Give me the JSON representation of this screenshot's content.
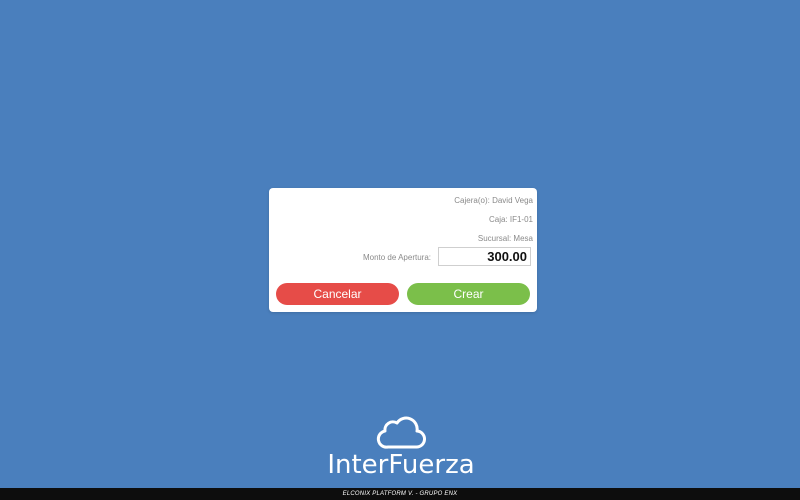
{
  "dialog": {
    "cashier_line": "Cajera(o): David Vega",
    "register_line": "Caja: IF1-01",
    "branch_line": "Sucursal: Mesa",
    "opening_amount_label": "Monto de Apertura:",
    "opening_amount_value": "300.00",
    "cancel_label": "Cancelar",
    "create_label": "Crear"
  },
  "logo": {
    "text": "InterFuerza",
    "icon": "cloud-icon"
  },
  "footer": {
    "text": "ELCONIX PLATFORM V. - GRUPO ENX"
  },
  "colors": {
    "background": "#4a7fbd",
    "cancel": "#e64c48",
    "create": "#7bbf4a",
    "footer": "#0d0d0d"
  }
}
